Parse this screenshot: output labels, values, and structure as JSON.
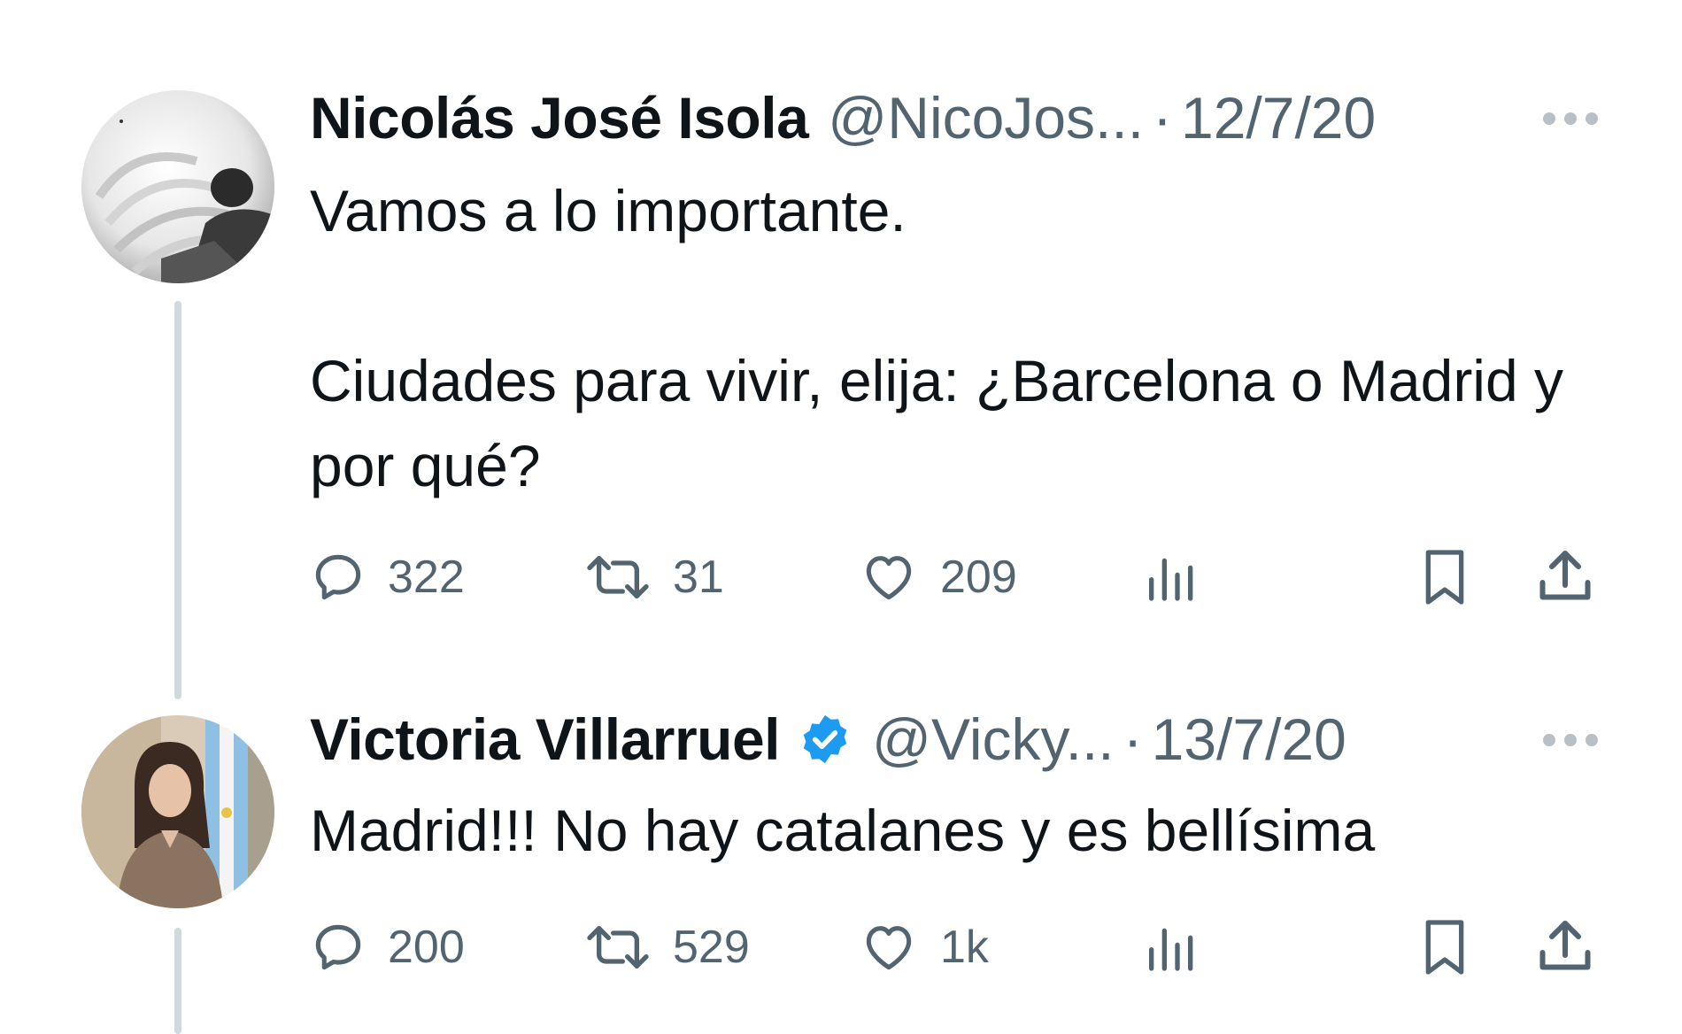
{
  "tweets": [
    {
      "name": "Nicolás José Isola",
      "handle": "@NicoJos...",
      "separator": "·",
      "date": "12/7/20",
      "verified": false,
      "text": "Vamos a lo importante.\n\nCiudades para vivir, elija: ¿Barcelona o Madrid y por qué?",
      "icons": {
        "more": "more-icon",
        "reply": "reply-icon",
        "retweet": "retweet-icon",
        "like": "heart-icon",
        "views": "views-icon",
        "bookmark": "bookmark-icon",
        "share": "share-icon"
      },
      "stats": {
        "replies": "322",
        "retweets": "31",
        "likes": "209"
      }
    },
    {
      "name": "Victoria Villarruel",
      "handle": "@Vicky...",
      "separator": "·",
      "date": "13/7/20",
      "verified": true,
      "text": "Madrid!!! No hay catalanes y es bellísima",
      "stats": {
        "replies": "200",
        "retweets": "529",
        "likes": "1k"
      }
    }
  ],
  "colors": {
    "text": "#0f1419",
    "secondary": "#536471",
    "verified_badge": "#1d9bf0",
    "thread_line": "#cfd9de"
  }
}
